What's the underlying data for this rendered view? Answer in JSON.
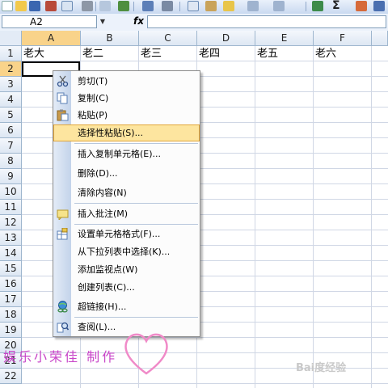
{
  "toolbar": {
    "icons": [
      "new-icon",
      "open-icon",
      "save-icon",
      "permission-icon",
      "email-icon",
      "print-icon",
      "print-preview-icon",
      "spelling-icon",
      "research-icon",
      "cut-icon",
      "copy-icon",
      "paste-icon",
      "format-painter-icon",
      "undo-icon",
      "redo-icon",
      "hyperlink-icon",
      "autosum-icon",
      "sort-icon"
    ],
    "autosum_symbol": "Σ"
  },
  "formula_bar": {
    "name_box": "A2",
    "fx_label": "fx",
    "formula": ""
  },
  "sheet": {
    "columns": [
      "A",
      "B",
      "C",
      "D",
      "E",
      "F"
    ],
    "active_column": "A",
    "rows": [
      "1",
      "2",
      "3",
      "4",
      "5",
      "6",
      "7",
      "8",
      "9",
      "10",
      "11",
      "12",
      "13",
      "14",
      "15",
      "16",
      "17",
      "18",
      "19",
      "20",
      "21",
      "22"
    ],
    "active_row": "2",
    "row1_values": [
      "老大",
      "老二",
      "老三",
      "老四",
      "老五",
      "老六"
    ],
    "selected_cell": "A2"
  },
  "context_menu": {
    "items": [
      {
        "label": "剪切(T)",
        "icon": "scissors-icon"
      },
      {
        "label": "复制(C)",
        "icon": "copy-icon"
      },
      {
        "label": "粘贴(P)",
        "icon": "paste-icon"
      },
      {
        "label": "选择性粘贴(S)...",
        "icon": "",
        "highlighted": true
      },
      {
        "label": "插入复制单元格(E)...",
        "icon": ""
      },
      {
        "label": "删除(D)...",
        "icon": ""
      },
      {
        "label": "清除内容(N)",
        "icon": ""
      },
      {
        "label": "插入批注(M)",
        "icon": "comment-icon"
      },
      {
        "label": "设置单元格格式(F)...",
        "icon": "format-cells-icon"
      },
      {
        "label": "从下拉列表中选择(K)...",
        "icon": ""
      },
      {
        "label": "添加监视点(W)",
        "icon": ""
      },
      {
        "label": "创建列表(C)...",
        "icon": ""
      },
      {
        "label": "超链接(H)...",
        "icon": "hyperlink-icon"
      },
      {
        "label": "查阅(L)...",
        "icon": "research-icon"
      }
    ]
  },
  "watermark": {
    "text": "娱乐小荣佳 制作",
    "baidu": "Bai度经验"
  },
  "colors": {
    "highlight_bg": "#fde59f",
    "highlight_border": "#e2a63a",
    "active_header": "#f9d38a",
    "watermark": "#c845c8"
  }
}
